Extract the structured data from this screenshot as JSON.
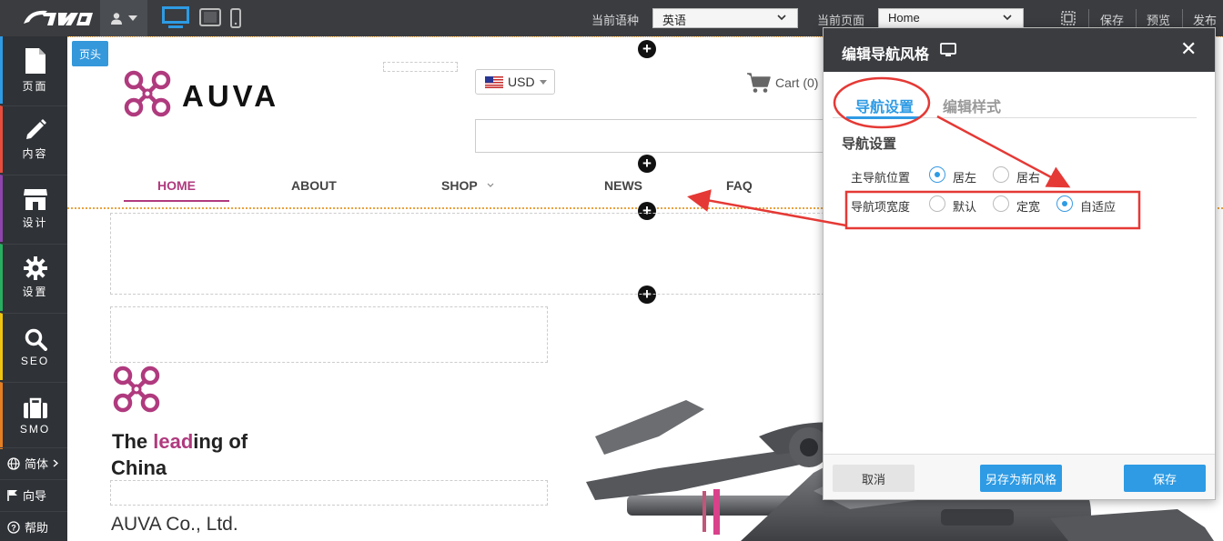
{
  "topbar": {
    "lang_label": "当前语种",
    "lang_value": "英语",
    "page_label": "当前页面",
    "page_value": "Home",
    "save": "保存",
    "preview": "预览",
    "publish": "发布"
  },
  "sidebar": {
    "items": [
      {
        "label": "页面",
        "icon": "page-icon",
        "accent": "#2e9be4"
      },
      {
        "label": "内容",
        "icon": "pencil-icon",
        "accent": "#e74c3c"
      },
      {
        "label": "设计",
        "icon": "store-icon",
        "accent": "#8e44ad"
      },
      {
        "label": "设置",
        "icon": "gear-icon",
        "accent": "#27ae60"
      },
      {
        "label": "SEO",
        "icon": "search-icon",
        "accent": "#f1c40f"
      },
      {
        "label": "SMO",
        "icon": "briefcase-icon",
        "accent": "#e67e22"
      }
    ],
    "lang_switch": "简体",
    "guide": "向导",
    "help": "帮助"
  },
  "canvas": {
    "header_tag": "页头",
    "brand": "AUVA",
    "currency": "USD",
    "cart": "Cart (0)",
    "nav": [
      "HOME",
      "ABOUT",
      "SHOP",
      "NEWS",
      "FAQ"
    ],
    "headline_1": "The ",
    "headline_hl": "lead",
    "headline_2": "ing  of",
    "headline_3": "China",
    "company": "AUVA Co., Ltd."
  },
  "modal": {
    "title": "编辑导航风格",
    "tabs": [
      "导航设置",
      "编辑样式"
    ],
    "section": "导航设置",
    "row1_label": "主导航位置",
    "row1_options": [
      "居左",
      "居右"
    ],
    "row1_selected": "居左",
    "row2_label": "导航项宽度",
    "row2_options": [
      "默认",
      "定宽",
      "自适应"
    ],
    "row2_selected": "自适应",
    "cancel": "取消",
    "save_as_new": "另存为新风格",
    "save": "保存"
  },
  "colors": {
    "accent_blue": "#2e9be4",
    "brand_magenta": "#b03a7e",
    "annotation_red": "#e53935",
    "toolbar_bg": "#3a3c40"
  }
}
